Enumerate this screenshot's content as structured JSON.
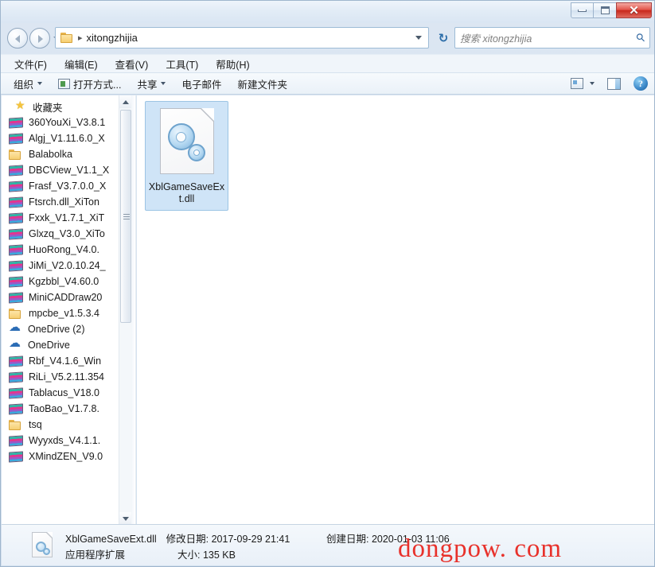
{
  "window": {
    "minimize_label": "最小化",
    "maximize_label": "最大化",
    "close_label": "✕"
  },
  "navigation": {
    "back_label": "后退",
    "forward_label": "前进",
    "recent_label": "最近浏览的位置",
    "refresh_label": "↻",
    "breadcrumb_separator": "▸",
    "breadcrumb": "xitongzhijia"
  },
  "search": {
    "placeholder": "搜索 xitongzhijia",
    "icon": "search-icon"
  },
  "menu": {
    "items": [
      {
        "label": "文件(F)"
      },
      {
        "label": "编辑(E)"
      },
      {
        "label": "查看(V)"
      },
      {
        "label": "工具(T)"
      },
      {
        "label": "帮助(H)"
      }
    ]
  },
  "toolbar": {
    "organize_label": "组织",
    "open_with_label": "打开方式...",
    "share_label": "共享",
    "email_label": "电子邮件",
    "new_folder_label": "新建文件夹",
    "views_icon": "views-icon",
    "preview_pane_icon": "preview-pane-icon",
    "help_icon": "?"
  },
  "sidebar": {
    "header": {
      "label": "收藏夹",
      "icon": "star-icon"
    },
    "items": [
      {
        "label": "360YouXi_V3.8.1",
        "icon": "archive-icon"
      },
      {
        "label": "Algj_V1.11.6.0_X",
        "icon": "archive-icon"
      },
      {
        "label": "Balabolka",
        "icon": "folder-icon"
      },
      {
        "label": "DBCView_V1.1_X",
        "icon": "archive-icon"
      },
      {
        "label": "Frasf_V3.7.0.0_X",
        "icon": "archive-icon"
      },
      {
        "label": "Ftsrch.dll_XiTon",
        "icon": "archive-icon"
      },
      {
        "label": "Fxxk_V1.7.1_XiT",
        "icon": "archive-icon"
      },
      {
        "label": "Glxzq_V3.0_XiTo",
        "icon": "archive-icon"
      },
      {
        "label": "HuoRong_V4.0.",
        "icon": "archive-icon"
      },
      {
        "label": "JiMi_V2.0.10.24_",
        "icon": "archive-icon"
      },
      {
        "label": "Kgzbbl_V4.60.0",
        "icon": "archive-icon"
      },
      {
        "label": "MiniCADDraw20",
        "icon": "archive-icon"
      },
      {
        "label": "mpcbe_v1.5.3.4",
        "icon": "folder-icon"
      },
      {
        "label": "OneDrive (2)",
        "icon": "cloud-icon"
      },
      {
        "label": "OneDrive",
        "icon": "cloud-icon"
      },
      {
        "label": "Rbf_V4.1.6_Win",
        "icon": "archive-icon"
      },
      {
        "label": "RiLi_V5.2.11.354",
        "icon": "archive-icon"
      },
      {
        "label": "Tablacus_V18.0",
        "icon": "archive-icon"
      },
      {
        "label": "TaoBao_V1.7.8.",
        "icon": "archive-icon"
      },
      {
        "label": "tsq",
        "icon": "folder-icon"
      },
      {
        "label": "Wyyxds_V4.1.1.",
        "icon": "archive-icon"
      },
      {
        "label": "XMindZEN_V9.0",
        "icon": "archive-icon"
      }
    ]
  },
  "files": [
    {
      "name": "XblGameSaveExt.dll",
      "icon": "dll-gear-icon",
      "selected": true
    }
  ],
  "statusbar": {
    "file_name": "XblGameSaveExt.dll",
    "modified_label": "修改日期: 2017-09-29 21:41",
    "created_label": "创建日期: 2020-01-03 11:06",
    "file_type": "应用程序扩展",
    "size_label": "大小: 135 KB"
  },
  "watermark": {
    "text": "dongpow. com",
    "color": "#e8312b"
  }
}
